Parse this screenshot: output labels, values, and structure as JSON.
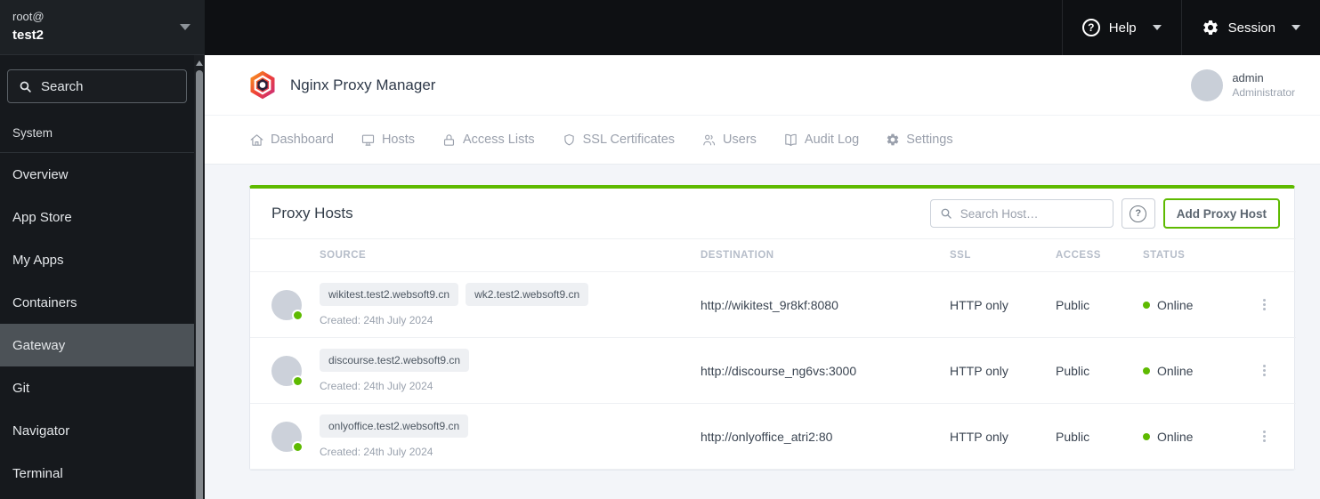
{
  "sidebar_header": {
    "user": "root@",
    "host": "test2"
  },
  "topbar": {
    "help_label": "Help",
    "help_glyph": "?",
    "session_label": "Session"
  },
  "sidebar": {
    "search_placeholder": "Search",
    "section_label": "System",
    "items": [
      {
        "label": "Overview",
        "active": false
      },
      {
        "label": "App Store",
        "active": false
      },
      {
        "label": "My Apps",
        "active": false
      },
      {
        "label": "Containers",
        "active": false
      },
      {
        "label": "Gateway",
        "active": true
      },
      {
        "label": "Git",
        "active": false
      },
      {
        "label": "Navigator",
        "active": false
      },
      {
        "label": "Terminal",
        "active": false
      }
    ]
  },
  "app_header": {
    "title": "Nginx Proxy Manager",
    "user_name": "admin",
    "user_role": "Administrator"
  },
  "nav_tabs": [
    {
      "label": "Dashboard",
      "icon": "home-icon"
    },
    {
      "label": "Hosts",
      "icon": "monitor-icon"
    },
    {
      "label": "Access Lists",
      "icon": "lock-icon"
    },
    {
      "label": "SSL Certificates",
      "icon": "shield-icon"
    },
    {
      "label": "Users",
      "icon": "users-icon"
    },
    {
      "label": "Audit Log",
      "icon": "book-icon"
    },
    {
      "label": "Settings",
      "icon": "gear-icon"
    }
  ],
  "panel": {
    "title": "Proxy Hosts",
    "search_placeholder": "Search Host…",
    "help_button_glyph": "?",
    "add_button_label": "Add Proxy Host"
  },
  "table": {
    "columns": [
      "SOURCE",
      "DESTINATION",
      "SSL",
      "ACCESS",
      "STATUS"
    ],
    "rows": [
      {
        "sources": [
          "wikitest.test2.websoft9.cn",
          "wk2.test2.websoft9.cn"
        ],
        "created": "Created: 24th July 2024",
        "destination": "http://wikitest_9r8kf:8080",
        "ssl": "HTTP only",
        "access": "Public",
        "status": "Online"
      },
      {
        "sources": [
          "discourse.test2.websoft9.cn"
        ],
        "created": "Created: 24th July 2024",
        "destination": "http://discourse_ng6vs:3000",
        "ssl": "HTTP only",
        "access": "Public",
        "status": "Online"
      },
      {
        "sources": [
          "onlyoffice.test2.websoft9.cn"
        ],
        "created": "Created: 24th July 2024",
        "destination": "http://onlyoffice_atri2:80",
        "ssl": "HTTP only",
        "access": "Public",
        "status": "Online"
      }
    ]
  },
  "colors": {
    "accent_green": "#5eba00",
    "online_dot": "#5eba00",
    "sidebar_bg": "#16191d",
    "sidebar_active_bg": "#4c5257",
    "topbar_bg": "#0e1013",
    "content_bg": "#f3f5f9"
  }
}
